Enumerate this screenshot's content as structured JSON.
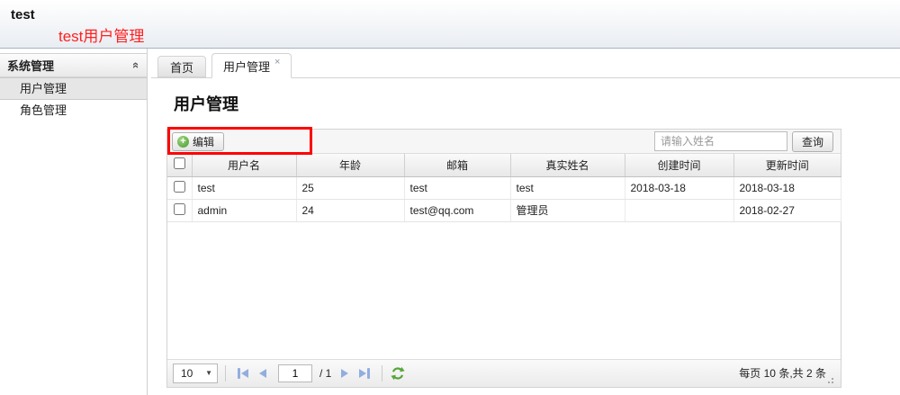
{
  "header": {
    "brand": "test",
    "subtitle": "test用户管理"
  },
  "sidebar": {
    "panel_title": "系统管理",
    "items": [
      {
        "label": "用户管理",
        "selected": true
      },
      {
        "label": "角色管理",
        "selected": false
      }
    ]
  },
  "tabs": {
    "home": "首页",
    "current": "用户管理",
    "close_icon": "×"
  },
  "page": {
    "title": "用户管理"
  },
  "toolbar": {
    "edit_label": "编辑",
    "edit_icon": "+",
    "search_placeholder": "请输入姓名",
    "search_value": "",
    "query_label": "查询"
  },
  "table": {
    "columns": [
      "用户名",
      "年龄",
      "邮箱",
      "真实姓名",
      "创建时间",
      "更新时间"
    ],
    "rows": [
      [
        "test",
        "25",
        "test",
        "test",
        "2018-03-18",
        "2018-03-18"
      ],
      [
        "admin",
        "24",
        "test@qq.com",
        "管理员",
        "",
        "2018-02-27"
      ]
    ]
  },
  "pager": {
    "page_size": "10",
    "page_number": "1",
    "total_label": "/ 1",
    "summary": "每页 10 条,共 2 条"
  },
  "colors": {
    "annotation_red": "#ff0000",
    "subtitle_red": "#ff1f1f",
    "pager_icon_blue": "#93ade0",
    "refresh_green": "#57a639",
    "edit_icon_green": "#4c9a33"
  }
}
